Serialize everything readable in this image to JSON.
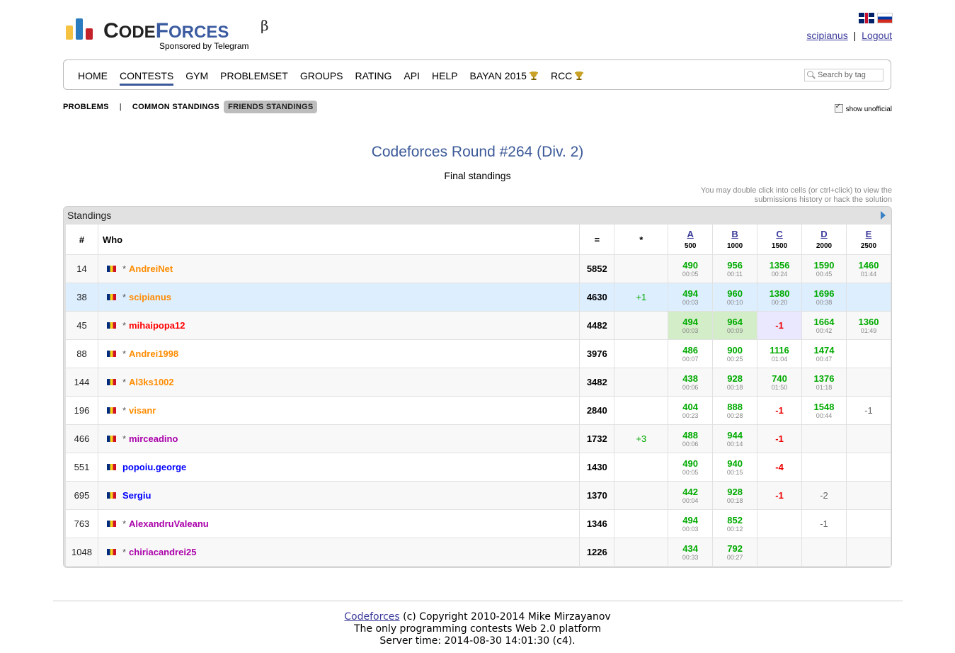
{
  "header": {
    "logo_word_first": "C",
    "logo_word_rest1": "ODE",
    "logo_word_forces": "F",
    "logo_word_rest2": "ORCES",
    "logo_beta": "β",
    "sponsor": "Sponsored by Telegram",
    "user": "scipianus",
    "separator": "|",
    "logout": "Logout"
  },
  "menu": {
    "items": [
      "HOME",
      "CONTESTS",
      "GYM",
      "PROBLEMSET",
      "GROUPS",
      "RATING",
      "API",
      "HELP",
      "BAYAN 2015",
      "RCC"
    ],
    "active": "CONTESTS",
    "search_placeholder": "Search by tag"
  },
  "submenu": {
    "problems": "PROBLEMS",
    "sep": "|",
    "common": "COMMON STANDINGS",
    "friends": "FRIENDS STANDINGS",
    "show_unofficial": "show unofficial"
  },
  "contest": {
    "title": "Codeforces Round #264 (Div. 2)",
    "subtitle": "Final standings",
    "hint_line1": "You may double click into cells (or ctrl+click) to view the",
    "hint_line2": "submissions history or hack the solution"
  },
  "standings": {
    "caption": "Standings",
    "headers": {
      "rank": "#",
      "who": "Who",
      "points": "=",
      "hacks": "*"
    },
    "problems": [
      {
        "letter": "A",
        "points": "500"
      },
      {
        "letter": "B",
        "points": "1000"
      },
      {
        "letter": "C",
        "points": "1500"
      },
      {
        "letter": "D",
        "points": "2000"
      },
      {
        "letter": "E",
        "points": "2500"
      }
    ],
    "rows": [
      {
        "rank": "14",
        "star": "*",
        "handle": "AndreiNet",
        "color": "orange",
        "points": "5852",
        "hacks": "",
        "cells": [
          [
            "490",
            "00:05"
          ],
          [
            "956",
            "00:11"
          ],
          [
            "1356",
            "00:24"
          ],
          [
            "1590",
            "00:45"
          ],
          [
            "1460",
            "01:44"
          ]
        ]
      },
      {
        "rank": "38",
        "star": "*",
        "handle": "scipianus",
        "color": "orange",
        "points": "4630",
        "hacks": "+1",
        "me": true,
        "cells": [
          [
            "494",
            "00:03"
          ],
          [
            "960",
            "00:10"
          ],
          [
            "1380",
            "00:20"
          ],
          [
            "1696",
            "00:38"
          ],
          [
            "",
            ""
          ]
        ]
      },
      {
        "rank": "45",
        "star": "*",
        "handle": "mihaipopa12",
        "color": "red",
        "points": "4482",
        "hacks": "",
        "cells": [
          [
            "494",
            "00:03",
            "first"
          ],
          [
            "964",
            "00:09",
            "first"
          ],
          [
            "-1",
            "",
            "pend"
          ],
          [
            "1664",
            "00:42"
          ],
          [
            "1360",
            "01:49"
          ]
        ]
      },
      {
        "rank": "88",
        "star": "*",
        "handle": "Andrei1998",
        "color": "orange",
        "points": "3976",
        "hacks": "",
        "cells": [
          [
            "486",
            "00:07"
          ],
          [
            "900",
            "00:25"
          ],
          [
            "1116",
            "01:04"
          ],
          [
            "1474",
            "00:47"
          ],
          [
            "",
            ""
          ]
        ]
      },
      {
        "rank": "144",
        "star": "*",
        "handle": "Al3ks1002",
        "color": "orange",
        "points": "3482",
        "hacks": "",
        "cells": [
          [
            "438",
            "00:06"
          ],
          [
            "928",
            "00:18"
          ],
          [
            "740",
            "01:50"
          ],
          [
            "1376",
            "01:18"
          ],
          [
            "",
            ""
          ]
        ]
      },
      {
        "rank": "196",
        "star": "*",
        "handle": "visanr",
        "color": "orange",
        "points": "2840",
        "hacks": "",
        "cells": [
          [
            "404",
            "00:23"
          ],
          [
            "888",
            "00:28"
          ],
          [
            "-1",
            ""
          ],
          [
            "1548",
            "00:44"
          ],
          [
            "-1",
            "",
            "fs"
          ]
        ]
      },
      {
        "rank": "466",
        "star": "*",
        "handle": "mirceadino",
        "color": "violet",
        "points": "1732",
        "hacks": "+3",
        "cells": [
          [
            "488",
            "00:06"
          ],
          [
            "944",
            "00:14"
          ],
          [
            "-1",
            ""
          ],
          [
            "",
            ""
          ],
          [
            "",
            ""
          ]
        ]
      },
      {
        "rank": "551",
        "star": "",
        "handle": "popoiu.george",
        "color": "blue",
        "points": "1430",
        "hacks": "",
        "cells": [
          [
            "490",
            "00:05"
          ],
          [
            "940",
            "00:15"
          ],
          [
            "-4",
            ""
          ],
          [
            "",
            ""
          ],
          [
            "",
            ""
          ]
        ]
      },
      {
        "rank": "695",
        "star": "",
        "handle": "Sergiu",
        "color": "blue",
        "points": "1370",
        "hacks": "",
        "cells": [
          [
            "442",
            "00:04"
          ],
          [
            "928",
            "00:18"
          ],
          [
            "-1",
            ""
          ],
          [
            "-2",
            "",
            "fs"
          ],
          [
            "",
            ""
          ]
        ]
      },
      {
        "rank": "763",
        "star": "*",
        "handle": "AlexandruValeanu",
        "color": "violet",
        "points": "1346",
        "hacks": "",
        "cells": [
          [
            "494",
            "00:03"
          ],
          [
            "852",
            "00:12"
          ],
          [
            "",
            ""
          ],
          [
            "-1",
            "",
            "fs"
          ],
          [
            "",
            ""
          ]
        ]
      },
      {
        "rank": "1048",
        "star": "*",
        "handle": "chiriacandrei25",
        "color": "violet",
        "points": "1226",
        "hacks": "",
        "cells": [
          [
            "434",
            "00:33"
          ],
          [
            "792",
            "00:27"
          ],
          [
            "",
            ""
          ],
          [
            "",
            ""
          ],
          [
            "",
            ""
          ]
        ]
      }
    ]
  },
  "footer": {
    "link": "Codeforces",
    "copyright": " (c) Copyright 2010-2014 Mike Mirzayanov",
    "line2": "The only programming contests Web 2.0 platform",
    "line3": "Server time: 2014-08-30 14:01:30 (c4)."
  },
  "colors": {
    "accent": "#3b5998",
    "accepted": "#00aa00",
    "rejected": "#ee0000",
    "first_solve": "#d4edc9",
    "pending": "#eae8ff",
    "my_row": "#ddeeff"
  }
}
